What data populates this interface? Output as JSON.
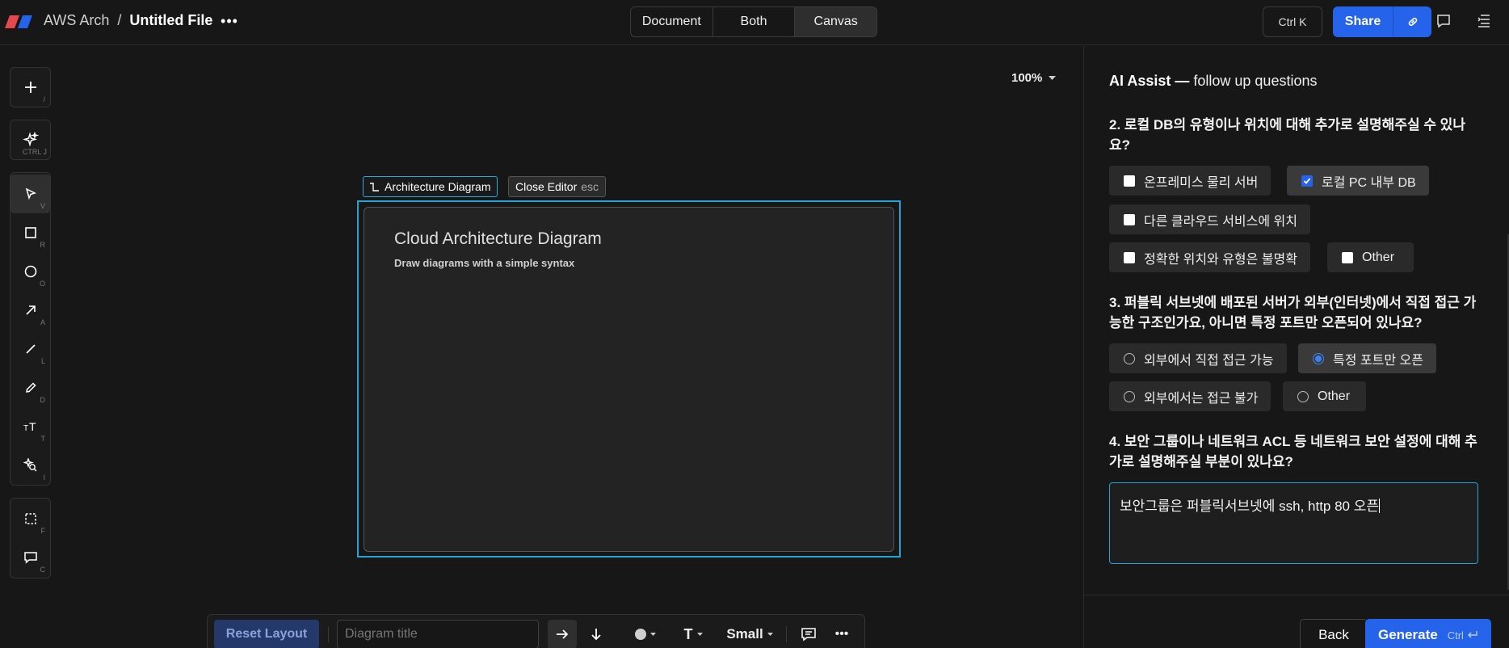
{
  "header": {
    "project": "AWS Arch",
    "separator": "/",
    "file_name": "Untitled File",
    "view_modes": [
      "Document",
      "Both",
      "Canvas"
    ],
    "active_view": "Canvas",
    "shortcut_label": "Ctrl K",
    "share_label": "Share",
    "brand_colors": [
      "#e5484d",
      "#2563eb"
    ]
  },
  "toolbar": {
    "tools": [
      {
        "name": "add",
        "key": "/"
      },
      {
        "name": "ai",
        "key": "CTRL J"
      },
      {
        "name": "select",
        "key": "V"
      },
      {
        "name": "rectangle",
        "key": "R"
      },
      {
        "name": "ellipse",
        "key": "O"
      },
      {
        "name": "arrow",
        "key": "A"
      },
      {
        "name": "line",
        "key": "L"
      },
      {
        "name": "draw",
        "key": "D"
      },
      {
        "name": "text",
        "key": "T"
      },
      {
        "name": "icon-search",
        "key": "I"
      },
      {
        "name": "frame",
        "key": "F"
      },
      {
        "name": "comment",
        "key": "C"
      }
    ]
  },
  "canvas": {
    "zoom": "100%",
    "diagram_chip": "Architecture Diagram",
    "close_editor": "Close Editor",
    "close_editor_key": "esc",
    "frame_title": "Cloud Architecture Diagram",
    "frame_subtitle": "Draw diagrams with a simple syntax",
    "accent_color": "#22a3d9"
  },
  "bottom_bar": {
    "reset_label": "Reset Layout",
    "title_placeholder": "Diagram title",
    "text_style": "T",
    "size_label": "Small"
  },
  "panel": {
    "header_bold": "AI Assist —",
    "header_rest": " follow up questions",
    "q2": {
      "text": "2. 로컬 DB의 유형이나 위치에 대해 추가로 설명해주실 수 있나요?",
      "options": [
        {
          "label": "온프레미스 물리 서버",
          "checked": false
        },
        {
          "label": "로컬 PC 내부 DB",
          "checked": true
        },
        {
          "label": "다른 클라우드 서비스에 위치",
          "checked": false
        },
        {
          "label": "정확한 위치와 유형은 불명확",
          "checked": false
        },
        {
          "label": "Other",
          "checked": false
        }
      ]
    },
    "q3": {
      "text": "3. 퍼블릭 서브넷에 배포된 서버가 외부(인터넷)에서 직접 접근 가능한 구조인가요, 아니면 특정 포트만 오픈되어 있나요?",
      "options": [
        {
          "label": "외부에서 직접 접근 가능",
          "checked": false
        },
        {
          "label": "특정 포트만 오픈",
          "checked": true
        },
        {
          "label": "외부에서는 접근 불가",
          "checked": false
        },
        {
          "label": "Other",
          "checked": false
        }
      ]
    },
    "q4": {
      "text": "4. 보안 그룹이나 네트워크 ACL 등 네트워크 보안 설정에 대해 추가로 설명해주실 부분이 있나요?",
      "answer": "보안그룹은 퍼블릭서브넷에 ssh, http 80 오픈"
    },
    "back_label": "Back",
    "generate_label": "Generate",
    "generate_hint": "Ctrl"
  }
}
